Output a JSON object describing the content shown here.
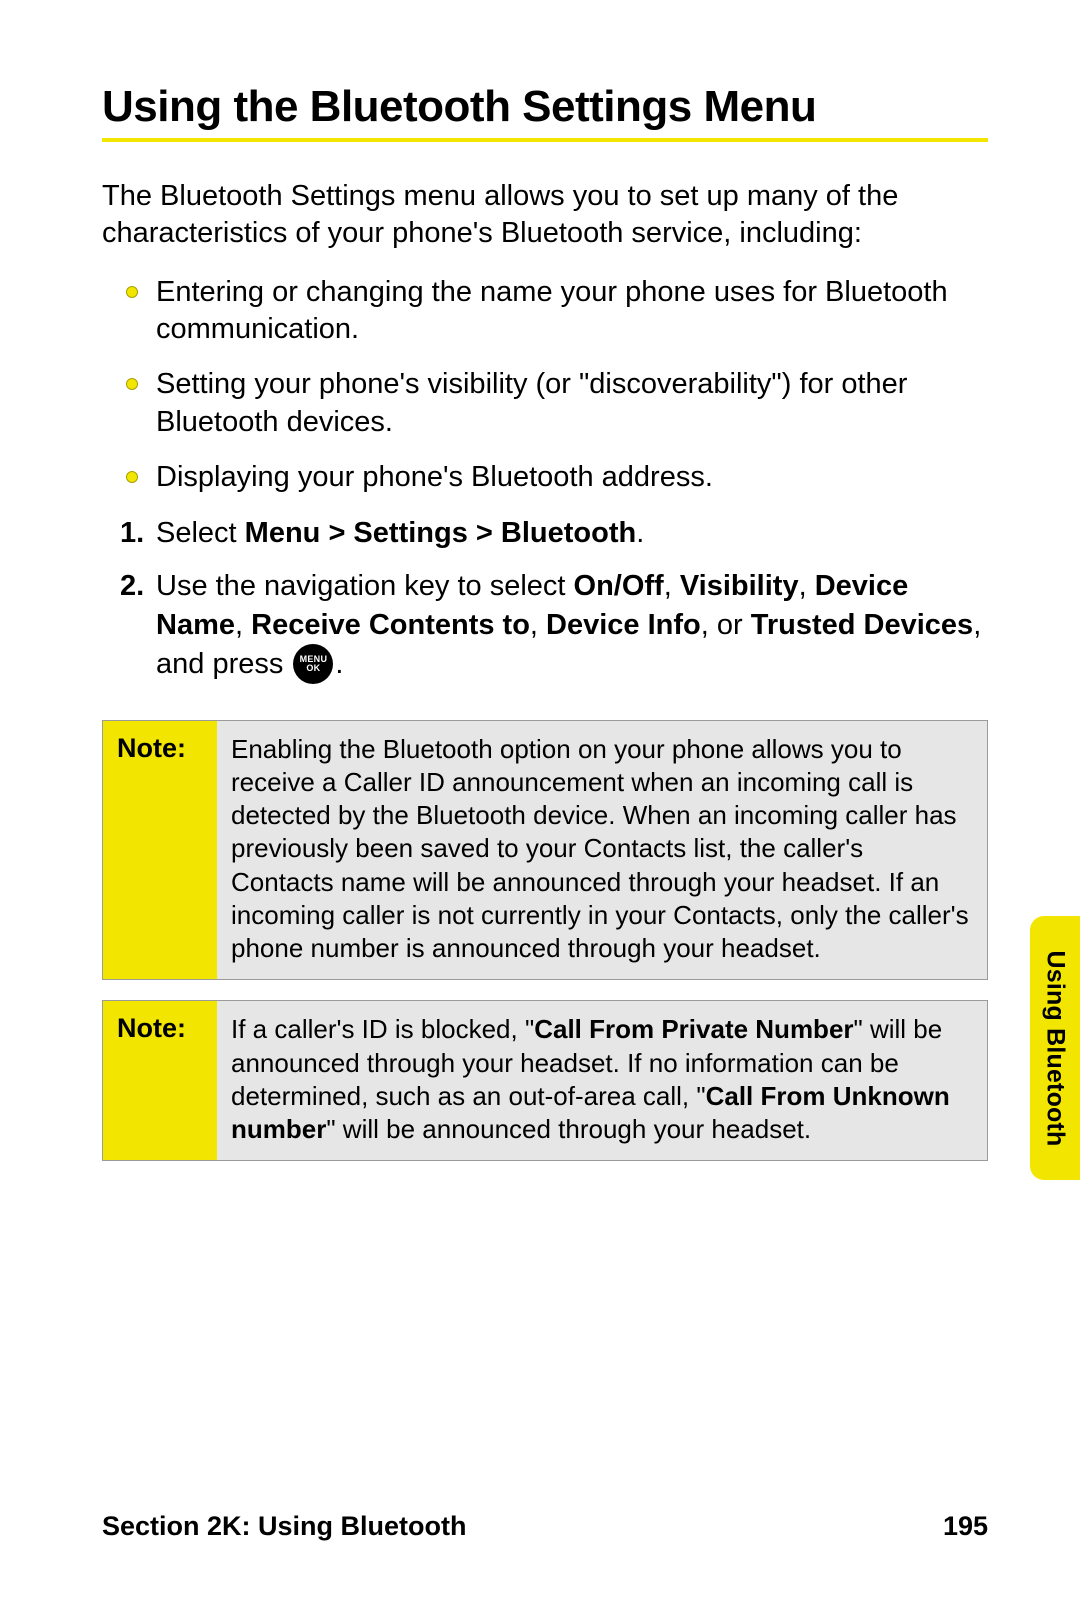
{
  "title": "Using the Bluetooth Settings Menu",
  "intro": "The Bluetooth Settings menu allows you to set up many of the characteristics of your phone's Bluetooth service, including:",
  "bullets": [
    "Entering or changing the name your phone uses for Bluetooth communication.",
    "Setting your phone's visibility (or \"discoverability\") for other Bluetooth devices.",
    "Displaying your phone's Bluetooth address."
  ],
  "step1_pre": "Select ",
  "step1_bold": "Menu > Settings > Bluetooth",
  "step1_post": ".",
  "step2_pre": "Use the navigation key to select ",
  "step2_b1": "On/Off",
  "step2_c1": ", ",
  "step2_b2": "Visibility",
  "step2_c2": ", ",
  "step2_b3": "Device Name",
  "step2_c3": ", ",
  "step2_b4": "Receive Contents to",
  "step2_c4": ", ",
  "step2_b5": "Device Info",
  "step2_c5": ", or ",
  "step2_b6": "Trusted Devices",
  "step2_post1": ", and press ",
  "step2_post2": ".",
  "menu_btn_top": "MENU",
  "menu_btn_bot": "OK",
  "note_label": "Note:",
  "note1_body": "Enabling the Bluetooth option on your phone allows you to receive a Caller ID announcement when an incoming call is detected by the Bluetooth device. When an incoming caller has previously been saved to your Contacts list, the caller's Contacts name will be announced through your headset. If an incoming caller is not currently in your Contacts, only the caller's phone number is announced through your headset.",
  "note2_p1": "If a caller's ID is blocked,  \"",
  "note2_b1": "Call From Private Number",
  "note2_p2": "\" will be announced through your headset. If no information can be determined, such as an out-of-area call, \"",
  "note2_b2": "Call From Unknown number",
  "note2_p3": "\" will be announced through your headset.",
  "side_tab": "Using Bluetooth",
  "footer_left": "Section 2K: Using Bluetooth",
  "footer_right": "195"
}
